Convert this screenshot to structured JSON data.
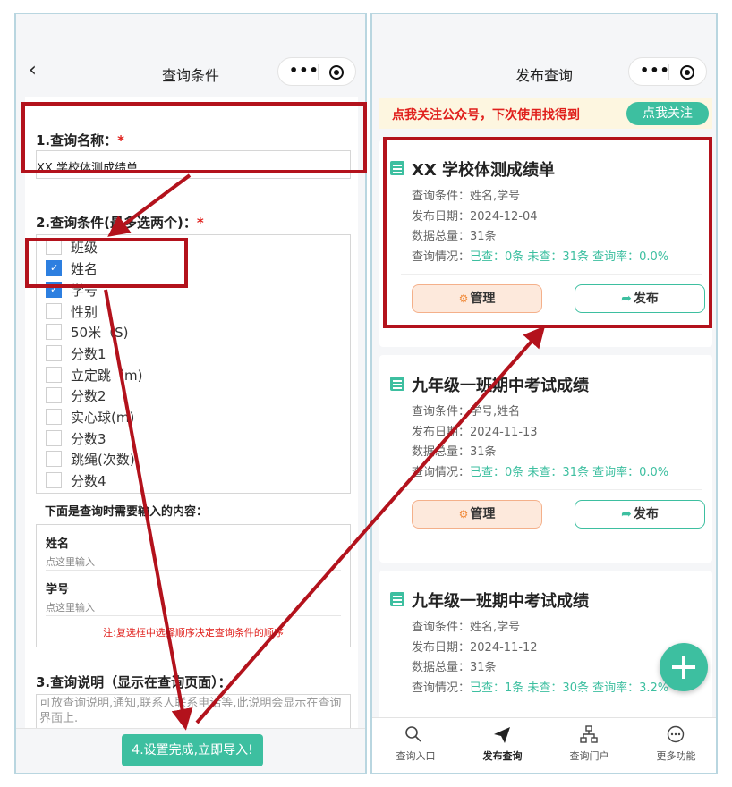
{
  "left": {
    "title": "查询条件",
    "capsule": {
      "more": "•••"
    },
    "query_name": {
      "label": "1.查询名称：",
      "required": "*",
      "value": "XX 学校体测成绩单"
    },
    "conditions": {
      "label": "2.查询条件(最多选两个)：",
      "required": "*",
      "options": [
        {
          "label": "班级",
          "checked": false
        },
        {
          "label": "姓名",
          "checked": true
        },
        {
          "label": "学号",
          "checked": true
        },
        {
          "label": "性别",
          "checked": false
        },
        {
          "label": "50米（S)",
          "checked": false
        },
        {
          "label": "分数1",
          "checked": false
        },
        {
          "label": "立定跳（m)",
          "checked": false
        },
        {
          "label": "分数2",
          "checked": false
        },
        {
          "label": "实心球(m)",
          "checked": false
        },
        {
          "label": "分数3",
          "checked": false
        },
        {
          "label": "跳绳(次数)",
          "checked": false
        },
        {
          "label": "分数4",
          "checked": false
        }
      ]
    },
    "inputs_header": "下面是查询时需要输入的内容：",
    "inputs": [
      {
        "name": "姓名",
        "placeholder": "点这里输入"
      },
      {
        "name": "学号",
        "placeholder": "点这里输入"
      }
    ],
    "note": "注:复选框中选择顺序决定查询条件的顺序",
    "description": {
      "label": "3.查询说明（显示在查询页面）：",
      "placeholder": "可放查询说明,通知,联系人联系电话等,此说明会显示在查询界面上."
    },
    "import_button": "4.设置完成,立即导入!"
  },
  "right": {
    "title": "发布查询",
    "capsule": {
      "more": "•••"
    },
    "banner": {
      "text": "点我关注公众号，下次使用找得到",
      "button": "点我关注"
    },
    "cards": [
      {
        "title": "XX 学校体测成绩单",
        "conditions": "查询条件：姓名,学号",
        "date": "发布日期：2024-12-04",
        "total": "数据总量：31条",
        "status_label": "查询情况：",
        "status": "已查：0条 未查：31条 查询率：0.0%",
        "manage": "管理",
        "publish": "发布"
      },
      {
        "title": "九年级一班期中考试成绩",
        "conditions": "查询条件：学号,姓名",
        "date": "发布日期：2024-11-13",
        "total": "数据总量：31条",
        "status_label": "查询情况：",
        "status": "已查：0条 未查：31条 查询率：0.0%",
        "manage": "管理",
        "publish": "发布"
      },
      {
        "title": "九年级一班期中考试成绩",
        "conditions": "查询条件：姓名,学号",
        "date": "发布日期：2024-11-12",
        "total": "数据总量：31条",
        "status_label": "查询情况：",
        "status": "已查：1条 未查：30条 查询率：3.2%"
      }
    ],
    "tabs": [
      {
        "label": "查询入口",
        "icon": "search-icon"
      },
      {
        "label": "发布查询",
        "icon": "send-icon",
        "active": true
      },
      {
        "label": "查询门户",
        "icon": "sitemap-icon"
      },
      {
        "label": "更多功能",
        "icon": "more-circle-icon"
      }
    ]
  },
  "colors": {
    "accent": "#3dbfa0",
    "annotation": "#b3121c",
    "required": "#e0201c",
    "check": "#2d7fe0"
  }
}
